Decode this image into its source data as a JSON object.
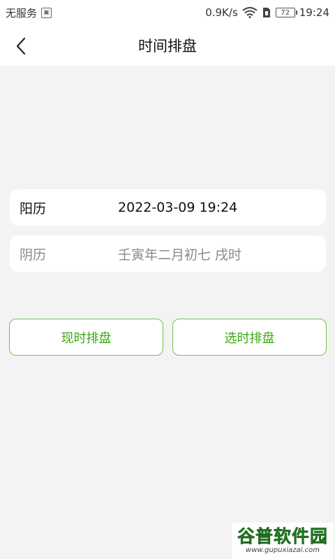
{
  "status_bar": {
    "carrier": "无服务",
    "speed": "0.9K/s",
    "battery": "72",
    "time": "19:24"
  },
  "header": {
    "title": "时间排盘"
  },
  "solar": {
    "label": "阳历",
    "value": "2022-03-09 19:24"
  },
  "lunar": {
    "label": "阴历",
    "value": "壬寅年二月初七 戌时"
  },
  "buttons": {
    "now": "现时排盘",
    "choose": "选时排盘"
  },
  "watermark": {
    "title": "谷普软件园",
    "url": "www.gupuxiazai.com"
  },
  "colors": {
    "accent": "#3aa80f",
    "border": "#6cc44a",
    "background": "#f3f3f3"
  }
}
